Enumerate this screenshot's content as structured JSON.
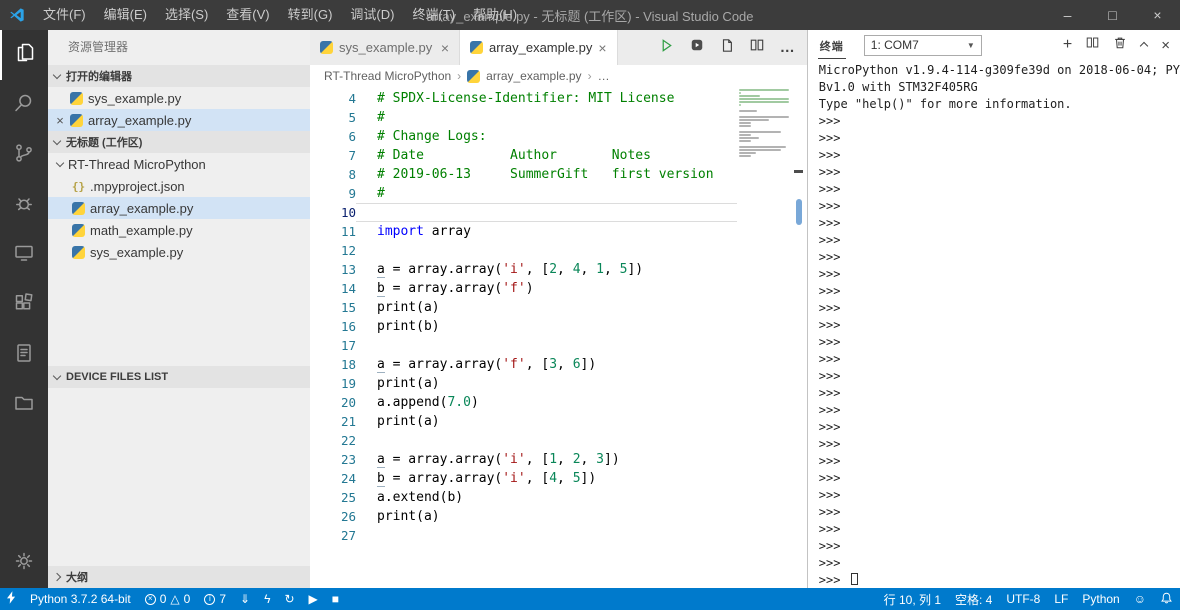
{
  "colors": {
    "accent": "#007acc",
    "titlebar": "#3c3c3c",
    "activitybar": "#333333",
    "sidebar": "#efefef",
    "selection": "#d2e3f5",
    "comment": "#008000",
    "keyword": "#0000ff",
    "string": "#a31515",
    "number": "#098658"
  },
  "icons": {
    "minimize": "–",
    "maximize": "□",
    "close": "×",
    "more": "…",
    "new_terminal": "+",
    "dropdown_arrow": "▼",
    "breadcrumb_sep": "›",
    "error_x": "×",
    "warning": "△",
    "info_i": "i",
    "download": "⇓",
    "flash": "ϟ",
    "sync": "↻",
    "run": "▶",
    "stop": "■",
    "smiley": "☺"
  },
  "titlebar": {
    "menus": [
      "文件(F)",
      "编辑(E)",
      "选择(S)",
      "查看(V)",
      "转到(G)",
      "调试(D)",
      "终端(T)",
      "帮助(H)"
    ],
    "title": "array_example.py - 无标题 (工作区) - Visual Studio Code"
  },
  "sidebar": {
    "title": "资源管理器",
    "sections": {
      "open_editors": {
        "label": "打开的编辑器",
        "items": [
          {
            "name": "sys_example.py",
            "icon": "py",
            "selected": false,
            "close": false
          },
          {
            "name": "array_example.py",
            "icon": "py",
            "selected": true,
            "close": true
          }
        ]
      },
      "workspace": {
        "label": "无标题 (工作区)",
        "folder": {
          "name": "RT-Thread MicroPython",
          "expanded": true
        },
        "files": [
          {
            "name": ".mpyproject.json",
            "icon": "json",
            "selected": false
          },
          {
            "name": "array_example.py",
            "icon": "py",
            "selected": true
          },
          {
            "name": "math_example.py",
            "icon": "py",
            "selected": false
          },
          {
            "name": "sys_example.py",
            "icon": "py",
            "selected": false
          }
        ]
      },
      "device_files": {
        "label": "DEVICE FILES LIST"
      },
      "outline": {
        "label": "大纲"
      }
    }
  },
  "editor": {
    "tabs": [
      {
        "label": "sys_example.py",
        "active": false
      },
      {
        "label": "array_example.py",
        "active": true
      }
    ],
    "breadcrumb": [
      "RT-Thread MicroPython",
      "array_example.py",
      "…"
    ],
    "current_line": 10,
    "lines": [
      {
        "n": 4,
        "t": [
          [
            "c",
            "# SPDX-License-Identifier: MIT License"
          ]
        ]
      },
      {
        "n": 5,
        "t": [
          [
            "c",
            "#"
          ]
        ]
      },
      {
        "n": 6,
        "t": [
          [
            "c",
            "# Change Logs:"
          ]
        ]
      },
      {
        "n": 7,
        "t": [
          [
            "c",
            "# Date           Author       Notes"
          ]
        ]
      },
      {
        "n": 8,
        "t": [
          [
            "c",
            "# 2019-06-13     SummerGift   first version"
          ]
        ]
      },
      {
        "n": 9,
        "t": [
          [
            "c",
            "#"
          ]
        ]
      },
      {
        "n": 10,
        "t": []
      },
      {
        "n": 11,
        "t": [
          [
            "k",
            "import"
          ],
          [
            "p",
            " array"
          ]
        ]
      },
      {
        "n": 12,
        "t": []
      },
      {
        "n": 13,
        "t": [
          [
            "v",
            "a"
          ],
          [
            "p",
            " = array.array("
          ],
          [
            "s",
            "'i'"
          ],
          [
            "p",
            ", ["
          ],
          [
            "num",
            "2"
          ],
          [
            "p",
            ", "
          ],
          [
            "num",
            "4"
          ],
          [
            "p",
            ", "
          ],
          [
            "num",
            "1"
          ],
          [
            "p",
            ", "
          ],
          [
            "num",
            "5"
          ],
          [
            "p",
            "])"
          ]
        ]
      },
      {
        "n": 14,
        "t": [
          [
            "v",
            "b"
          ],
          [
            "p",
            " = array.array("
          ],
          [
            "s",
            "'f'"
          ],
          [
            "p",
            ")"
          ]
        ]
      },
      {
        "n": 15,
        "t": [
          [
            "p",
            "print(a)"
          ]
        ]
      },
      {
        "n": 16,
        "t": [
          [
            "p",
            "print(b)"
          ]
        ]
      },
      {
        "n": 17,
        "t": []
      },
      {
        "n": 18,
        "t": [
          [
            "v",
            "a"
          ],
          [
            "p",
            " = array.array("
          ],
          [
            "s",
            "'f'"
          ],
          [
            "p",
            ", ["
          ],
          [
            "num",
            "3"
          ],
          [
            "p",
            ", "
          ],
          [
            "num",
            "6"
          ],
          [
            "p",
            "])"
          ]
        ]
      },
      {
        "n": 19,
        "t": [
          [
            "p",
            "print(a)"
          ]
        ]
      },
      {
        "n": 20,
        "t": [
          [
            "p",
            "a.append("
          ],
          [
            "num",
            "7.0"
          ],
          [
            "p",
            ")"
          ]
        ]
      },
      {
        "n": 21,
        "t": [
          [
            "p",
            "print(a)"
          ]
        ]
      },
      {
        "n": 22,
        "t": []
      },
      {
        "n": 23,
        "t": [
          [
            "v",
            "a"
          ],
          [
            "p",
            " = array.array("
          ],
          [
            "s",
            "'i'"
          ],
          [
            "p",
            ", ["
          ],
          [
            "num",
            "1"
          ],
          [
            "p",
            ", "
          ],
          [
            "num",
            "2"
          ],
          [
            "p",
            ", "
          ],
          [
            "num",
            "3"
          ],
          [
            "p",
            "])"
          ]
        ]
      },
      {
        "n": 24,
        "t": [
          [
            "v",
            "b"
          ],
          [
            "p",
            " = array.array("
          ],
          [
            "s",
            "'i'"
          ],
          [
            "p",
            ", ["
          ],
          [
            "num",
            "4"
          ],
          [
            "p",
            ", "
          ],
          [
            "num",
            "5"
          ],
          [
            "p",
            "])"
          ]
        ]
      },
      {
        "n": 25,
        "t": [
          [
            "p",
            "a.extend(b)"
          ]
        ]
      },
      {
        "n": 26,
        "t": [
          [
            "p",
            "print(a)"
          ]
        ]
      },
      {
        "n": 27,
        "t": []
      }
    ]
  },
  "terminal": {
    "tab": "终端",
    "selector": "1: COM7",
    "intro": [
      "MicroPython v1.9.4-114-g309fe39d on 2018-06-04; PY",
      "Bv1.0 with STM32F405RG",
      "Type \"help()\" for more information."
    ],
    "prompt": ">>>",
    "prompt_count": 27,
    "cursor_line": ">>> "
  },
  "statusbar": {
    "left": {
      "interpreter": "Python 3.7.2 64-bit",
      "errors": "0",
      "warnings": "0",
      "info": "7"
    },
    "right": {
      "cursor": "行 10, 列 1",
      "indent": "空格: 4",
      "encoding": "UTF-8",
      "eol": "LF",
      "language": "Python"
    }
  }
}
